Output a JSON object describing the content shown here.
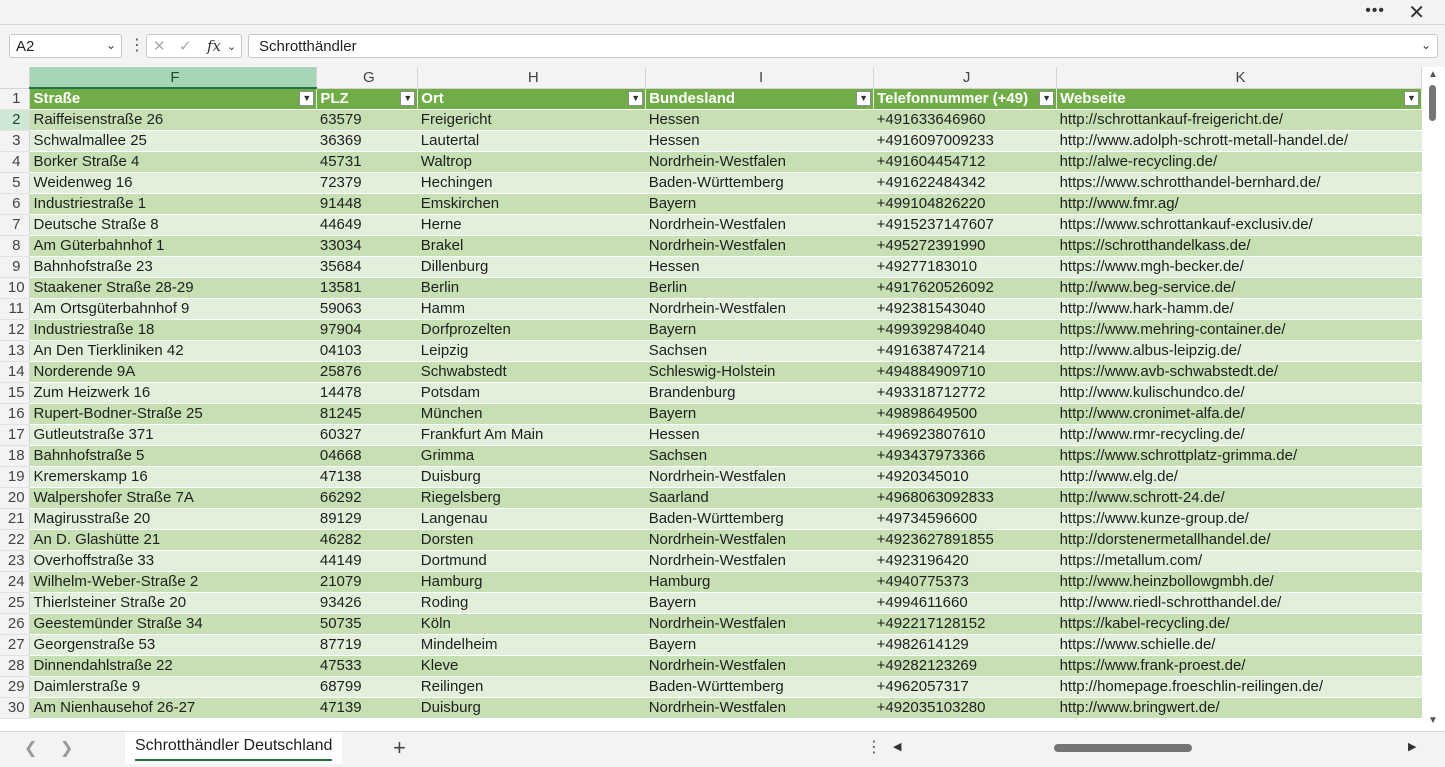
{
  "window": {
    "more_label": "•••",
    "close_label": "✕"
  },
  "formula_bar": {
    "name_box": "A2",
    "dots": "⋮",
    "cancel_icon": "✕",
    "enter_icon": "✓",
    "fx_label": "fx",
    "value": "Schrotthändler"
  },
  "columns": [
    "F",
    "G",
    "H",
    "I",
    "J",
    "K"
  ],
  "header_row": {
    "row_number": "1",
    "cells": [
      "Straße",
      "PLZ",
      "Ort",
      "Bundesland",
      "Telefonnummer (+49)",
      "Webseite"
    ]
  },
  "rows": [
    [
      "2",
      "Raiffeisenstraße 26",
      "63579",
      "Freigericht",
      "Hessen",
      "+491633646960",
      "http://schrottankauf-freigericht.de/"
    ],
    [
      "3",
      "Schwalmallee 25",
      "36369",
      "Lautertal",
      "Hessen",
      "+4916097009233",
      "http://www.adolph-schrott-metall-handel.de/"
    ],
    [
      "4",
      "Borker Straße 4",
      "45731",
      "Waltrop",
      "Nordrhein-Westfalen",
      "+491604454712",
      "http://alwe-recycling.de/"
    ],
    [
      "5",
      "Weidenweg 16",
      "72379",
      "Hechingen",
      "Baden-Württemberg",
      "+491622484342",
      "https://www.schrotthandel-bernhard.de/"
    ],
    [
      "6",
      "Industriestraße 1",
      "91448",
      "Emskirchen",
      "Bayern",
      "+499104826220",
      "http://www.fmr.ag/"
    ],
    [
      "7",
      "Deutsche Straße 8",
      "44649",
      "Herne",
      "Nordrhein-Westfalen",
      "+4915237147607",
      "https://www.schrottankauf-exclusiv.de/"
    ],
    [
      "8",
      "Am Güterbahnhof 1",
      "33034",
      "Brakel",
      "Nordrhein-Westfalen",
      "+495272391990",
      "https://schrotthandelkass.de/"
    ],
    [
      "9",
      "Bahnhofstraße 23",
      "35684",
      "Dillenburg",
      "Hessen",
      "+49277183010",
      "https://www.mgh-becker.de/"
    ],
    [
      "10",
      "Staakener Straße 28-29",
      "13581",
      "Berlin",
      "Berlin",
      "+4917620526092",
      "http://www.beg-service.de/"
    ],
    [
      "11",
      "Am Ortsgüterbahnhof 9",
      "59063",
      "Hamm",
      "Nordrhein-Westfalen",
      "+492381543040",
      "http://www.hark-hamm.de/"
    ],
    [
      "12",
      "Industriestraße 18",
      "97904",
      "Dorfprozelten",
      "Bayern",
      "+499392984040",
      "https://www.mehring-container.de/"
    ],
    [
      "13",
      "An Den Tierkliniken 42",
      "04103",
      "Leipzig",
      "Sachsen",
      "+491638747214",
      "http://www.albus-leipzig.de/"
    ],
    [
      "14",
      "Norderende 9A",
      "25876",
      "Schwabstedt",
      "Schleswig-Holstein",
      "+494884909710",
      "https://www.avb-schwabstedt.de/"
    ],
    [
      "15",
      "Zum Heizwerk 16",
      "14478",
      "Potsdam",
      "Brandenburg",
      "+493318712772",
      "http://www.kulischundco.de/"
    ],
    [
      "16",
      "Rupert-Bodner-Straße 25",
      "81245",
      "München",
      "Bayern",
      "+49898649500",
      "http://www.cronimet-alfa.de/"
    ],
    [
      "17",
      "Gutleutstraße 371",
      "60327",
      "Frankfurt Am Main",
      "Hessen",
      "+496923807610",
      "http://www.rmr-recycling.de/"
    ],
    [
      "18",
      "Bahnhofstraße 5",
      "04668",
      "Grimma",
      "Sachsen",
      "+493437973366",
      "https://www.schrottplatz-grimma.de/"
    ],
    [
      "19",
      "Kremerskamp 16",
      "47138",
      "Duisburg",
      "Nordrhein-Westfalen",
      "+4920345010",
      "http://www.elg.de/"
    ],
    [
      "20",
      "Walpershofer Straße 7A",
      "66292",
      "Riegelsberg",
      "Saarland",
      "+4968063092833",
      "http://www.schrott-24.de/"
    ],
    [
      "21",
      "Magirusstraße 20",
      "89129",
      "Langenau",
      "Baden-Württemberg",
      "+49734596600",
      "https://www.kunze-group.de/"
    ],
    [
      "22",
      "An D. Glashütte 21",
      "46282",
      "Dorsten",
      "Nordrhein-Westfalen",
      "+4923627891855",
      "http://dorstenermetallhandel.de/"
    ],
    [
      "23",
      "Overhoffstraße 33",
      "44149",
      "Dortmund",
      "Nordrhein-Westfalen",
      "+4923196420",
      "https://metallum.com/"
    ],
    [
      "24",
      "Wilhelm-Weber-Straße 2",
      "21079",
      "Hamburg",
      "Hamburg",
      "+4940775373",
      "http://www.heinzbollowgmbh.de/"
    ],
    [
      "25",
      "Thierlsteiner Straße 20",
      "93426",
      "Roding",
      "Bayern",
      "+4994611660",
      "http://www.riedl-schrotthandel.de/"
    ],
    [
      "26",
      "Geestemünder Straße 34",
      "50735",
      "Köln",
      "Nordrhein-Westfalen",
      "+492217128152",
      "https://kabel-recycling.de/"
    ],
    [
      "27",
      "Georgenstraße 53",
      "87719",
      "Mindelheim",
      "Bayern",
      "+4982614129",
      "https://www.schielle.de/"
    ],
    [
      "28",
      "Dinnendahlstraße 22",
      "47533",
      "Kleve",
      "Nordrhein-Westfalen",
      "+49282123269",
      "https://www.frank-proest.de/"
    ],
    [
      "29",
      "Daimlerstraße 9",
      "68799",
      "Reilingen",
      "Baden-Württemberg",
      "+4962057317",
      "http://homepage.froeschlin-reilingen.de/"
    ],
    [
      "30",
      "Am Nienhausehof 26-27",
      "47139",
      "Duisburg",
      "Nordrhein-Westfalen",
      "+492035103280",
      "http://www.bringwert.de/"
    ]
  ],
  "sheet_tabs": {
    "active": "Schrotthändler Deutschland",
    "add_label": "+"
  },
  "colors": {
    "header_green": "#70ad47",
    "band_dark": "#c6e0b4",
    "band_light": "#e2efda",
    "accent": "#217346"
  }
}
